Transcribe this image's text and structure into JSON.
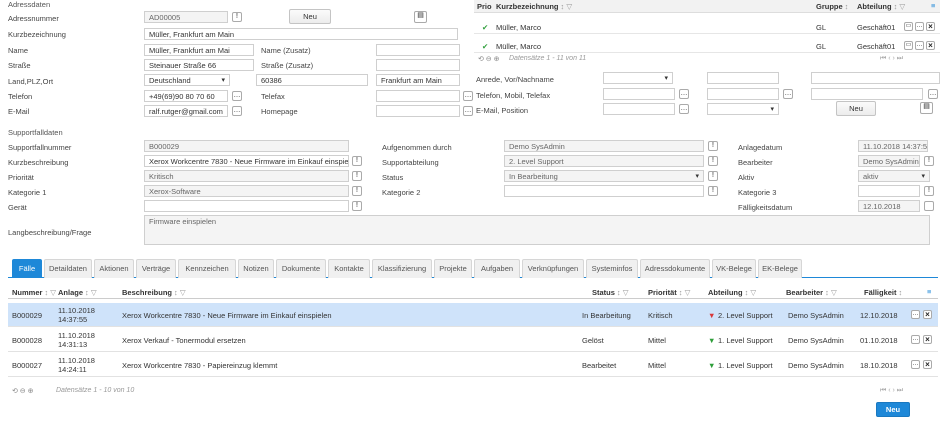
{
  "address": {
    "section_label": "Adressdaten",
    "number_label": "Adressnummer",
    "number_value": "AD00005",
    "new_button": "Neu",
    "short_label": "Kurzbezeichnung",
    "short_value": "Müller, Frankfurt am Main",
    "name_label": "Name",
    "name_value": "Müller, Frankfurt am Mai",
    "name_extra_label": "Name (Zusatz)",
    "street_label": "Straße",
    "street_value": "Steinauer Straße 66",
    "street_extra_label": "Straße (Zusatz)",
    "country_label": "Land,PLZ,Ort",
    "country_value": "Deutschland",
    "zip_value": "60386",
    "city_value": "Frankfurt am Main",
    "phone_label": "Telefon",
    "phone_value": "+49(69)90 80 70 60",
    "fax_label": "Telefax",
    "email_label": "E-Mail",
    "email_value": "ralf.rutger@gmail.com",
    "homepage_label": "Homepage"
  },
  "contacts": {
    "headers": {
      "prio": "Prio",
      "name": "Kurzbezeichnung",
      "group": "Gruppe",
      "dept": "Abteilung"
    },
    "rows": [
      {
        "name": "Müller, Marco",
        "group": "GL",
        "dept": "Geschäft01"
      },
      {
        "name": "Müller, Marco",
        "group": "GL",
        "dept": "Geschäft01"
      }
    ],
    "pager": "Datensätze 1 - 11 von 11",
    "salutation_label": "Anrede, Vor/Nachname",
    "phone_label": "Telefon, Mobil, Telefax",
    "email_label": "E-Mail, Position",
    "new_button": "Neu"
  },
  "support": {
    "section_label": "Supportfalldaten",
    "number_label": "Supportfallnummer",
    "number_value": "B000029",
    "desc_label": "Kurzbeschreibung",
    "desc_value": "Xerox Workcentre 7830 - Neue Firmware im Einkauf einspielen",
    "priority_label": "Priorität",
    "priority_value": "Kritisch",
    "category1_label": "Kategorie 1",
    "category1_value": "Xerox-Software",
    "device_label": "Gerät",
    "long_desc_label": "Langbeschreibung/Frage",
    "long_desc_value": "Firmware einspielen",
    "recorded_label": "Aufgenommen durch",
    "recorded_value": "Demo SysAdmin",
    "support_dept_label": "Supportabteilung",
    "support_dept_value": "2. Level Support",
    "status_label": "Status",
    "status_value": "In Bearbeitung",
    "category2_label": "Kategorie 2",
    "created_label": "Anlagedatum",
    "created_value": "11.10.2018 14:37:55",
    "editor_label": "Bearbeiter",
    "editor_value": "Demo SysAdmin",
    "active_label": "Aktiv",
    "active_value": "aktiv",
    "category3_label": "Kategorie 3",
    "due_label": "Fälligkeitsdatum",
    "due_value": "12.10.2018"
  },
  "tabs": [
    "Fälle",
    "Detaildaten",
    "Aktionen",
    "Verträge",
    "Kennzeichen",
    "Notizen",
    "Dokumente",
    "Kontakte",
    "Klassifizierung",
    "Projekte",
    "Aufgaben",
    "Verknüpfungen",
    "Systeminfos",
    "Adressdokumente",
    "VK-Belege",
    "EK-Belege"
  ],
  "cases": {
    "headers": {
      "number": "Nummer",
      "created": "Anlage",
      "desc": "Beschreibung",
      "status": "Status",
      "priority": "Priorität",
      "dept": "Abteilung",
      "editor": "Bearbeiter",
      "due": "Fälligkeit"
    },
    "rows": [
      {
        "number": "B000029",
        "date": "11.10.2018",
        "time": "14:37:55",
        "desc": "Xerox Workcentre 7830 - Neue Firmware im Einkauf einspielen",
        "status": "In Bearbeitung",
        "priority": "Kritisch",
        "dept": "2. Level Support",
        "editor": "Demo SysAdmin",
        "due": "12.10.2018"
      },
      {
        "number": "B000028",
        "date": "11.10.2018",
        "time": "14:31:13",
        "desc": "Xerox Verkauf - Tonermodul ersetzen",
        "status": "Gelöst",
        "priority": "Mittel",
        "dept": "1. Level Support",
        "editor": "Demo SysAdmin",
        "due": "01.10.2018"
      },
      {
        "number": "B000027",
        "date": "11.10.2018",
        "time": "14:24:11",
        "desc": "Xerox Workcentre 7830 - Papiereinzug klemmt",
        "status": "Bearbeitet",
        "priority": "Mittel",
        "dept": "1. Level Support",
        "editor": "Demo SysAdmin",
        "due": "18.10.2018"
      }
    ],
    "pager": "Datensätze 1 - 10 von 10",
    "new_button": "Neu"
  },
  "colors": {
    "accent": "#1e88d8",
    "selected_row": "#cfe3fa",
    "green_check": "#2e9e3a",
    "filter_red": "#d9383a",
    "filter_green": "#2e9e3a"
  }
}
